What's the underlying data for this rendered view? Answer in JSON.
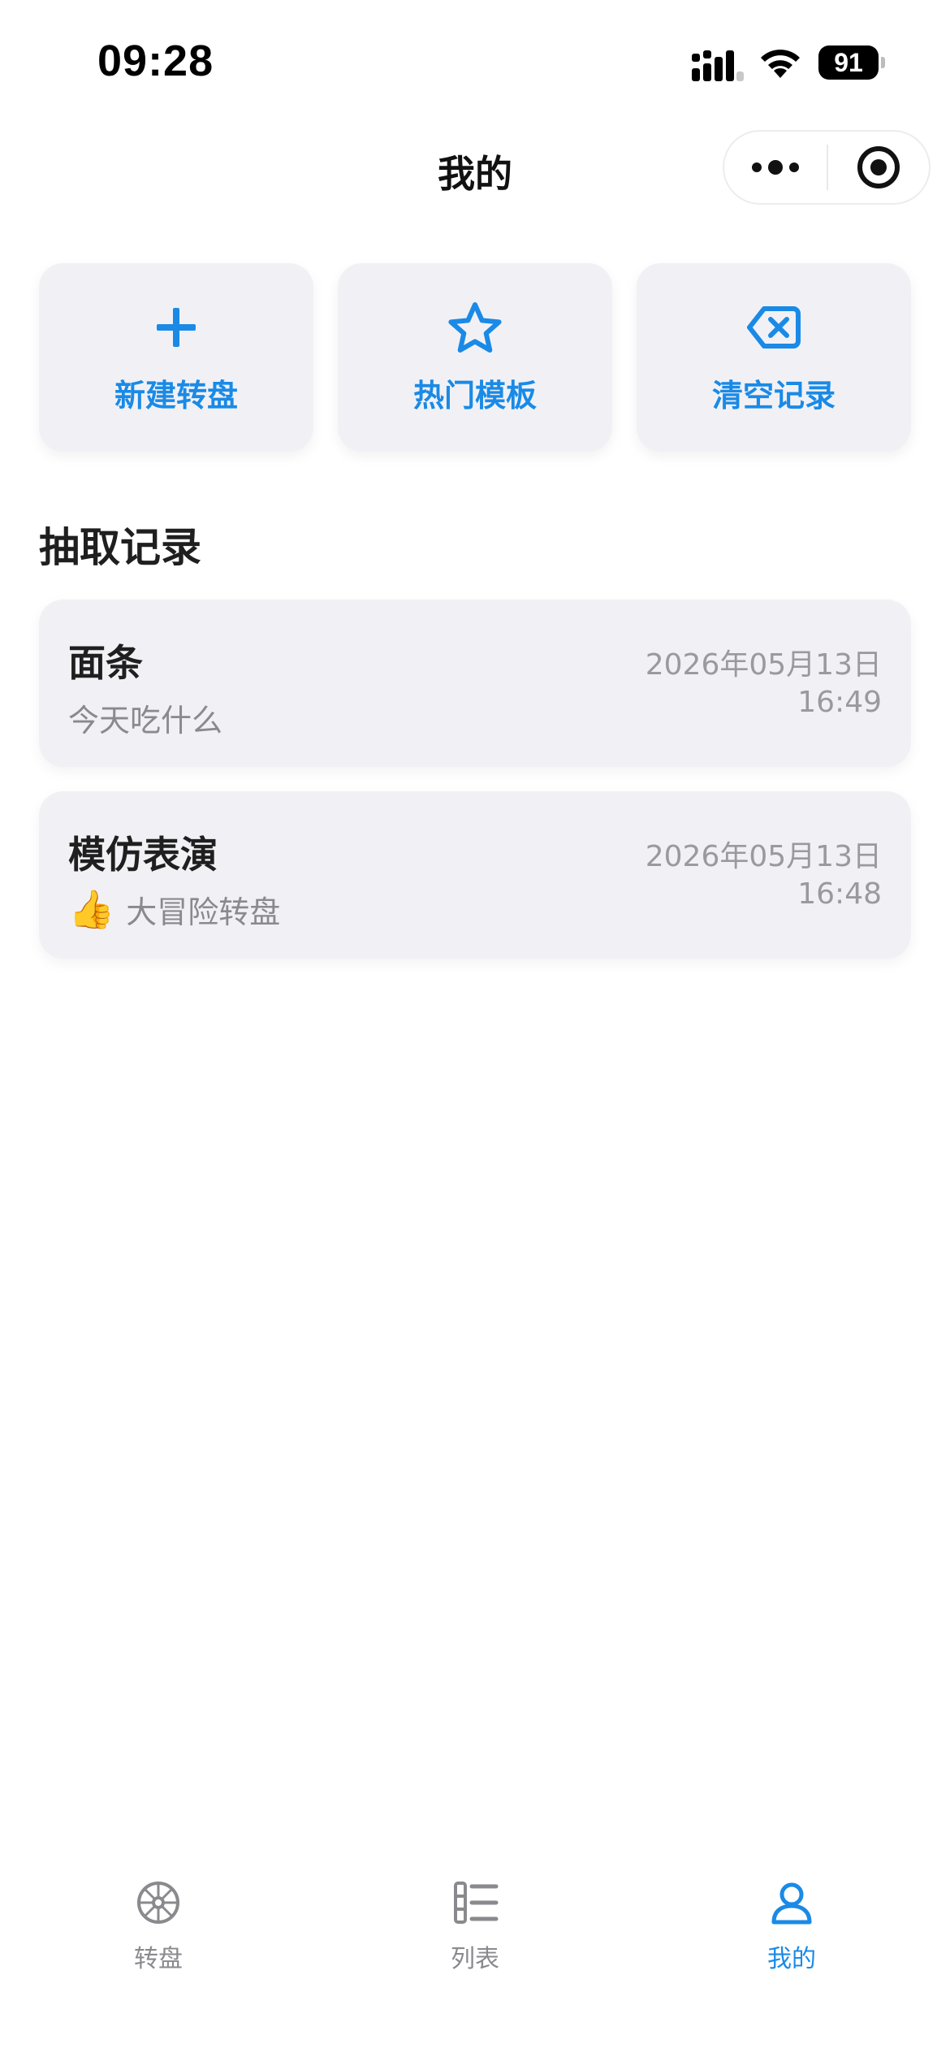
{
  "status_bar": {
    "time": "09:28",
    "battery_level": "91"
  },
  "nav": {
    "title": "我的",
    "more_icon": "more-dots-icon",
    "close_icon": "target-circle-icon"
  },
  "actions": [
    {
      "label": "新建转盘",
      "icon": "plus-icon"
    },
    {
      "label": "热门模板",
      "icon": "star-icon"
    },
    {
      "label": "清空记录",
      "icon": "backspace-clear-icon"
    }
  ],
  "records_section": {
    "title": "抽取记录",
    "items": [
      {
        "title": "面条",
        "subtitle": "今天吃什么",
        "emoji": "",
        "date": "2026年05月13日",
        "time": "16:49"
      },
      {
        "title": "模仿表演",
        "subtitle": "大冒险转盘",
        "emoji": "👍",
        "date": "2026年05月13日",
        "time": "16:48"
      }
    ]
  },
  "tab_bar": {
    "items": [
      {
        "label": "转盘",
        "icon": "wheel-icon",
        "active": false
      },
      {
        "label": "列表",
        "icon": "list-icon",
        "active": false
      },
      {
        "label": "我的",
        "icon": "user-icon",
        "active": true
      }
    ]
  },
  "colors": {
    "accent": "#1a8ae6",
    "card_bg": "#f1f1f5",
    "muted_text": "#8a8a8e"
  }
}
